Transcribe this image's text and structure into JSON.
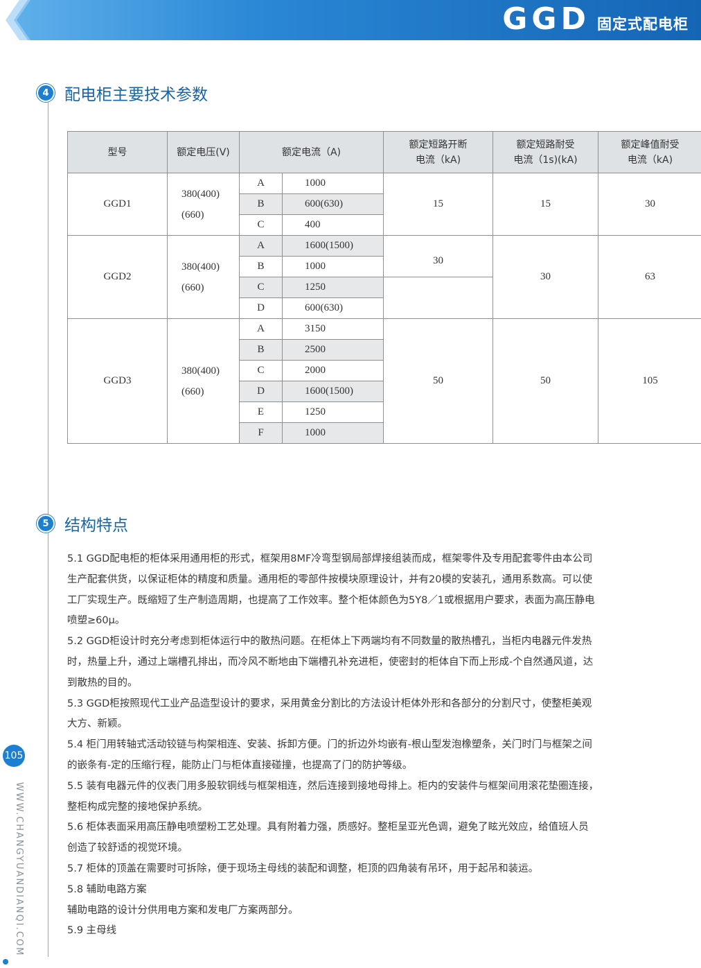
{
  "header": {
    "brand": "GGD",
    "subtitle": "固定式配电柜"
  },
  "section4": {
    "num": "4",
    "title": "配电柜主要技术参数"
  },
  "table": {
    "headers": {
      "model": "型号",
      "voltage": "额定电压(V)",
      "current": "额定电流（A)",
      "breaking_1": "额定短路开断",
      "breaking_2": "电流（kA)",
      "withstand_1": "额定短路耐受",
      "withstand_2": "电流（1s)(kA)",
      "peak_1": "额定峰值耐受",
      "peak_2": "电流（kA)"
    },
    "groups": [
      {
        "model": "GGD1",
        "voltage_1": "380(400)",
        "voltage_2": "(660)",
        "breaking": "15",
        "withstand": "15",
        "peak": "30",
        "rows": [
          {
            "class": "A",
            "current": "1000"
          },
          {
            "class": "B",
            "current": "600(630)"
          },
          {
            "class": "C",
            "current": "400"
          }
        ]
      },
      {
        "model": "GGD2",
        "voltage_1": "380(400)",
        "voltage_2": "(660)",
        "breaking": "30",
        "withstand": "30",
        "peak": "63",
        "rows": [
          {
            "class": "A",
            "current": "1600(1500)"
          },
          {
            "class": "B",
            "current": "1000"
          },
          {
            "class": "C",
            "current": "1250"
          },
          {
            "class": "D",
            "current": "600(630)"
          }
        ]
      },
      {
        "model": "GGD3",
        "voltage_1": "380(400)",
        "voltage_2": "(660)",
        "breaking": "50",
        "withstand": "50",
        "peak": "105",
        "rows": [
          {
            "class": "A",
            "current": "3150"
          },
          {
            "class": "B",
            "current": "2500"
          },
          {
            "class": "C",
            "current": "2000"
          },
          {
            "class": "D",
            "current": "1600(1500)"
          },
          {
            "class": "E",
            "current": "1250"
          },
          {
            "class": "F",
            "current": "1000"
          }
        ]
      }
    ]
  },
  "section5": {
    "num": "5",
    "title": "结构特点"
  },
  "body_lines": [
    "5.1  GGD配电柜的柜体采用通用柜的形式，框架用8MF冷弯型钢局部焊接组装而成，框架零件及专用配套零件由本公司",
    "生产配套供货，以保证柜体的精度和质量。通用柜的零部件按模块原理设计，并有20模的安装孔，通用系数高。可以使",
    "工厂实现生产。既缩短了生产制造周期，也提高了工作效率。整个柜体颜色为5Y8／1或根据用户要求，表面为高压静电",
    "喷塑≥60μ。",
    "5.2  GGD柜设计时充分考虑到柜体运行中的散热问题。在柜体上下两端均有不同数量的散热槽孔，当柜内电器元件发热",
    "时，热量上升，通过上端槽孔排出，而冷风不断地由下端槽孔补充进柜，使密封的柜体自下而上形成-个自然通风道，达",
    "到散热的目的。",
    "5.3 GGD柜按照现代工业产品造型设计的要求，采用黄金分割比的方法设计柜体外形和各部分的分割尺寸，使整柜美观",
    "大方、新颖。",
    "5.4  柜门用转轴式活动铰链与构架相连、安装、拆卸方便。门的折边外均嵌有-根山型发泡橡塑条，关门时门与框架之间",
    "的嵌条有-定的压缩行程，能防止门与柜体直接碰撞，也提高了门的防护等级。",
    "5.5  装有电器元件的仪表门用多股软铜线与框架相连，然后连接到接地母排上。柜内的安装件与框架间用滚花垫圈连接，",
    "整柜构成完整的接地保护系统。",
    "5.6  柜体表面采用高压静电喷塑粉工艺处理。具有附着力强，质感好。整柜呈亚光色调，避免了眩光效应，给值班人员",
    "创造了较舒适的视觉环境。",
    "5.7  柜体的顶盖在需要时可拆除，便于现场主母线的装配和调整，柜顶的四角装有吊环，用于起吊和装运。",
    "5.8  辅助电路方案",
    "辅助电路的设计分供用电方案和发电厂方案两部分。",
    "5.9  主母线"
  ],
  "page_number": "105",
  "side_url": "WWW.CHANGYUANDIANQI.COM",
  "colors": {
    "brand_blue": "#1d7fd1",
    "header_dark": "#1565b5",
    "title_blue": "#1765a9"
  }
}
